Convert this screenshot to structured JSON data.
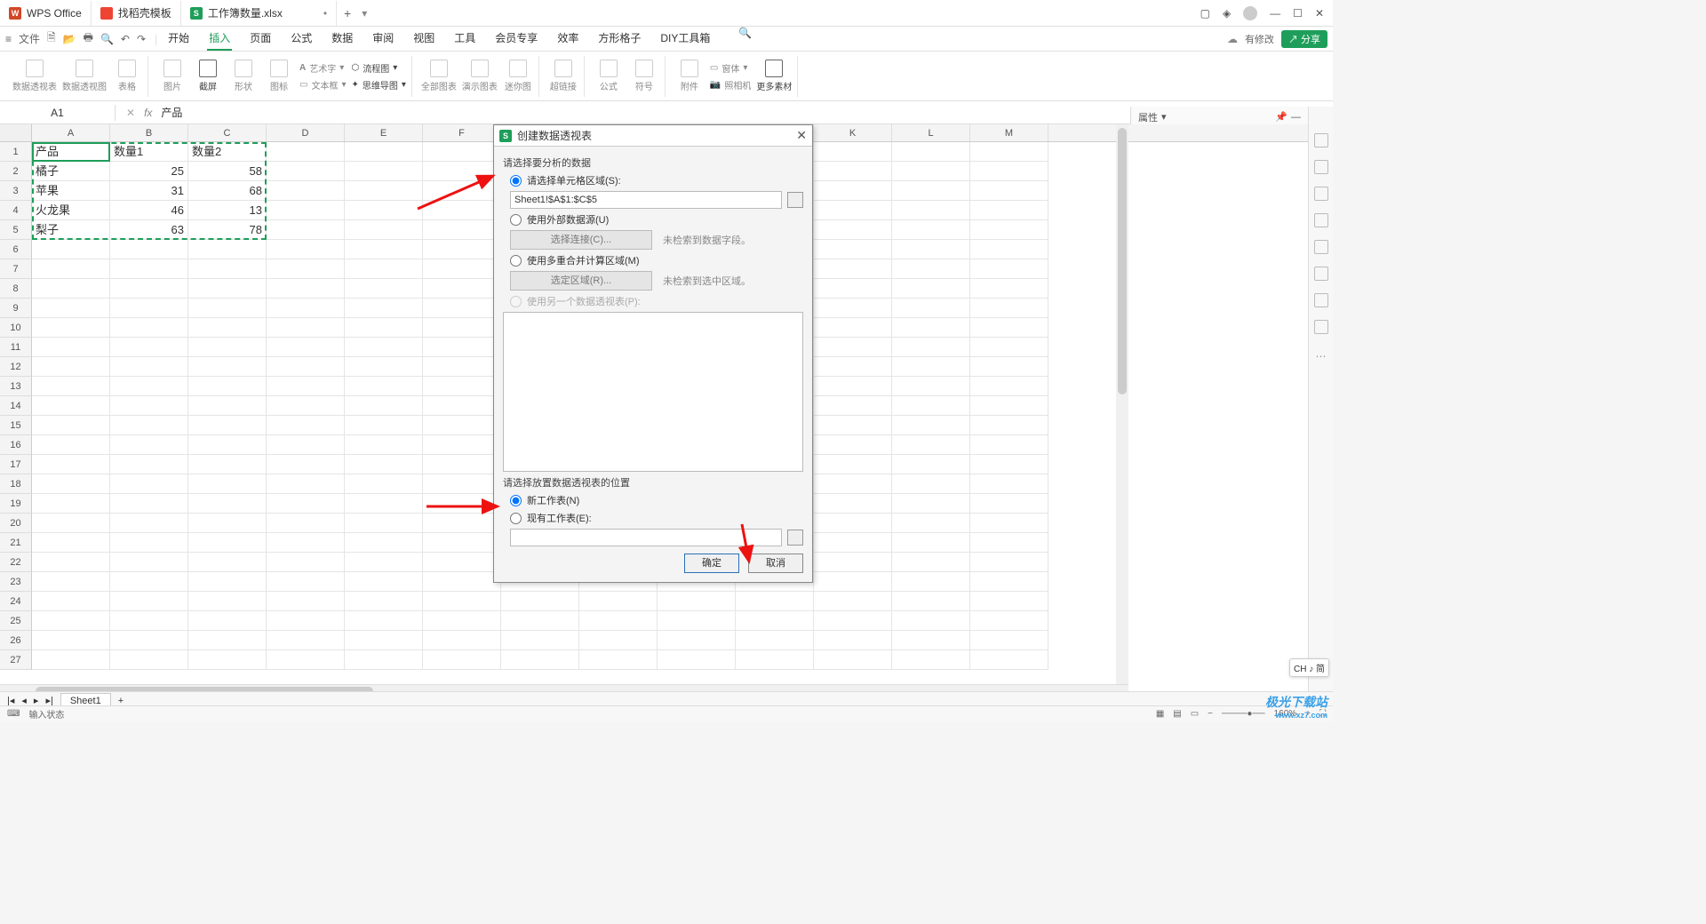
{
  "titlebar": {
    "tabs": [
      {
        "icon": "W",
        "label": "WPS Office"
      },
      {
        "icon": "D",
        "label": "找稻壳模板"
      },
      {
        "icon": "S",
        "label": "工作簿数量.xlsx",
        "dirty": "•"
      }
    ],
    "add": "+"
  },
  "menubar": {
    "file": "文件",
    "tabs": [
      "开始",
      "插入",
      "页面",
      "公式",
      "数据",
      "审阅",
      "视图",
      "工具",
      "会员专享",
      "效率",
      "方形格子",
      "DIY工具箱"
    ],
    "active_index": 1,
    "modified": "有修改",
    "share": "分享"
  },
  "ribbon": {
    "items": [
      "数据透视表",
      "数据透视图",
      "表格",
      "图片",
      "截屏",
      "形状",
      "图标",
      "艺术字",
      "文本框",
      "流程图",
      "思维导图",
      "全部图表",
      "演示图表",
      "迷你图",
      "超链接",
      "公式",
      "符号",
      "附件",
      "窗体",
      "照相机",
      "更多素材"
    ]
  },
  "formula": {
    "namebox": "A1",
    "fx": "fx",
    "value": "产品"
  },
  "sheet": {
    "cols": [
      "A",
      "B",
      "C",
      "D",
      "E",
      "F",
      "G",
      "H",
      "I",
      "J",
      "K",
      "L",
      "M"
    ],
    "data": [
      [
        "产品",
        "数量1",
        "数量2"
      ],
      [
        "橘子",
        "25",
        "58"
      ],
      [
        "苹果",
        "31",
        "68"
      ],
      [
        "火龙果",
        "46",
        "13"
      ],
      [
        "梨子",
        "63",
        "78"
      ]
    ],
    "row_count": 27
  },
  "dialog": {
    "title": "创建数据透视表",
    "section1": "请选择要分析的数据",
    "opt_range": "请选择单元格区域(S):",
    "range_value": "Sheet1!$A$1:$C$5",
    "opt_external": "使用外部数据源(U)",
    "btn_conn": "选择连接(C)...",
    "note_conn": "未检索到数据字段。",
    "opt_multi": "使用多重合并计算区域(M)",
    "btn_region": "选定区域(R)...",
    "note_region": "未检索到选中区域。",
    "opt_another": "使用另一个数据透视表(P):",
    "section2": "请选择放置数据透视表的位置",
    "opt_new": "新工作表(N)",
    "opt_exist": "现有工作表(E):",
    "ok": "确定",
    "cancel": "取消"
  },
  "properties": {
    "label": "属性"
  },
  "sheettabs": {
    "name": "Sheet1",
    "add": "+"
  },
  "status": {
    "left1": "输入状态",
    "zoom": "160%"
  },
  "ime": "CH ♪ 简",
  "watermark": {
    "brand": "极光下载站",
    "url": "www.xz7.com"
  }
}
